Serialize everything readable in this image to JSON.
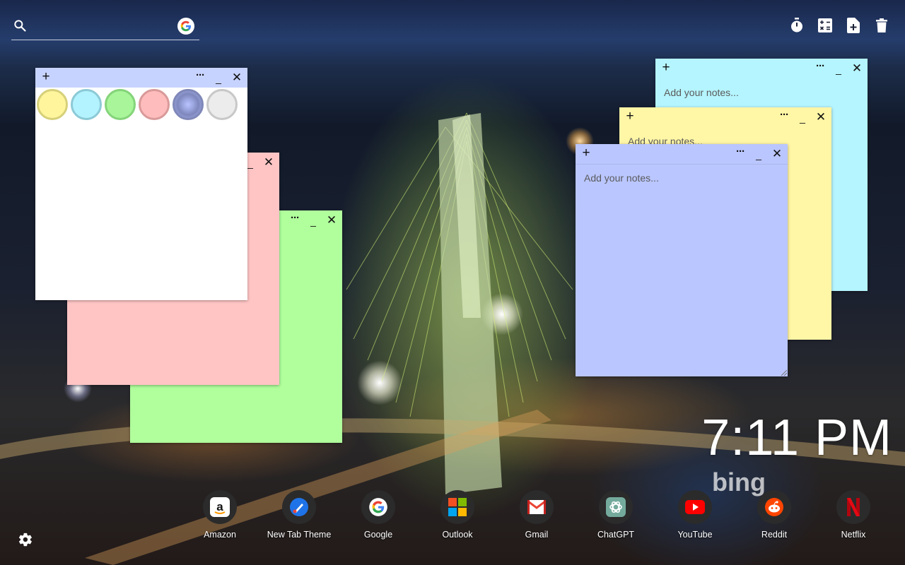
{
  "search": {
    "placeholder": ""
  },
  "top_tools": [
    {
      "name": "timer-icon"
    },
    {
      "name": "calculator-icon"
    },
    {
      "name": "new-note-icon"
    },
    {
      "name": "trash-icon"
    }
  ],
  "notes": {
    "white": {
      "color": "#ffffff",
      "bar_color": "#c7d3ff"
    },
    "pink": {
      "color": "#ffc5c5"
    },
    "green": {
      "color": "#b0ff9c"
    },
    "cyan": {
      "color": "#b5f5ff",
      "placeholder": "Add your notes..."
    },
    "yellow": {
      "color": "#fff6a6",
      "placeholder": "Add your notes..."
    },
    "purple": {
      "color": "#bac6ff",
      "placeholder": "Add your notes..."
    }
  },
  "palette": [
    "yellow",
    "cyan",
    "green",
    "pink",
    "purple",
    "gray"
  ],
  "clock": {
    "time": "7:11 PM"
  },
  "branding": {
    "logo": "bing"
  },
  "shortcuts": [
    {
      "label": "Amazon",
      "icon": "amazon-icon"
    },
    {
      "label": "New Tab Theme",
      "icon": "new-tab-theme-icon"
    },
    {
      "label": "Google",
      "icon": "google-icon"
    },
    {
      "label": "Outlook",
      "icon": "outlook-icon"
    },
    {
      "label": "Gmail",
      "icon": "gmail-icon"
    },
    {
      "label": "ChatGPT",
      "icon": "chatgpt-icon"
    },
    {
      "label": "YouTube",
      "icon": "youtube-icon"
    },
    {
      "label": "Reddit",
      "icon": "reddit-icon"
    },
    {
      "label": "Netflix",
      "icon": "netflix-icon"
    }
  ]
}
